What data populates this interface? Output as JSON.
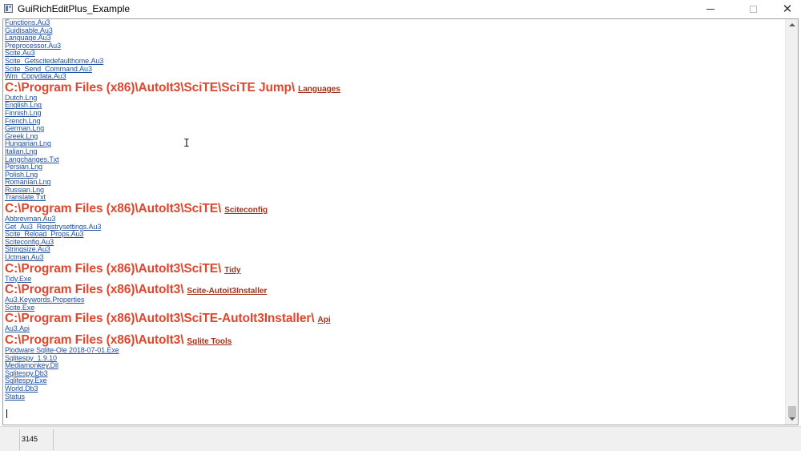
{
  "window": {
    "title": "GuiRichEditPlus_Example"
  },
  "blocks": [
    {
      "type": "files",
      "items": [
        "Functions.Au3",
        "Guidisable.Au3",
        "Language.Au3",
        "Preprocessor.Au3",
        "Scite.Au3",
        "Scite_Getscitedefaulthome.Au3",
        "Scite_Send_Command.Au3",
        "Wm_Copydata.Au3"
      ]
    },
    {
      "type": "heading",
      "path": "C:\\Program Files (x86)\\AutoIt3\\SciTE\\SciTE Jump\\",
      "link": "Languages"
    },
    {
      "type": "files",
      "items": [
        "Dutch.Lng",
        "English.Lng",
        "Finnish.Lng",
        "French.Lng",
        "German.Lng",
        "Greek.Lng",
        "Hungarian.Lng",
        "Italian.Lng",
        "Langchanges.Txt",
        "Persian.Lng",
        "Polish.Lng",
        "Romanian.Lng",
        "Russian.Lng",
        "Translate.Txt"
      ]
    },
    {
      "type": "heading",
      "path": "C:\\Program Files (x86)\\AutoIt3\\SciTE\\",
      "link": "Sciteconfig"
    },
    {
      "type": "files",
      "items": [
        "Abbrevman.Au3",
        "Get_Au3_Registrysettings.Au3",
        "Scite_Reload_Props.Au3",
        "Sciteconfig.Au3",
        "Stringsize.Au3",
        "Uctman.Au3"
      ]
    },
    {
      "type": "heading",
      "path": "C:\\Program Files (x86)\\AutoIt3\\SciTE\\",
      "link": "Tidy"
    },
    {
      "type": "files",
      "items": [
        "Tidy.Exe"
      ]
    },
    {
      "type": "heading",
      "path": "C:\\Program Files (x86)\\AutoIt3\\",
      "link": "Scite-Autoit3Installer"
    },
    {
      "type": "files",
      "items": [
        "Au3.Keywords.Properties",
        "Scite.Exe"
      ]
    },
    {
      "type": "heading",
      "path": "C:\\Program Files (x86)\\AutoIt3\\SciTE-AutoIt3Installer\\",
      "link": "Api"
    },
    {
      "type": "files",
      "items": [
        "Au3.Api"
      ]
    },
    {
      "type": "heading",
      "path": "C:\\Program Files (x86)\\AutoIt3\\",
      "link": "Sqlite Tools"
    },
    {
      "type": "files",
      "items": [
        "Plodware Sqlite-Ole 2018-07-01.Exe",
        "Sqlitespy_1.9.10",
        "Mediamonkey.Dll",
        "Sqlitespy.Db3",
        "Sqlitespy.Exe",
        "World.Db3",
        "Status"
      ]
    }
  ],
  "statusbar": {
    "count": "3145"
  },
  "colors": {
    "heading_path": "#e0462e",
    "heading_link": "#a0321c",
    "file_link": "#1f4f9f"
  },
  "icons": {
    "app": "app-icon",
    "minimize": "minimize-icon",
    "maximize": "maximize-icon",
    "close": "close-icon",
    "cursor": "text-cursor-icon"
  }
}
